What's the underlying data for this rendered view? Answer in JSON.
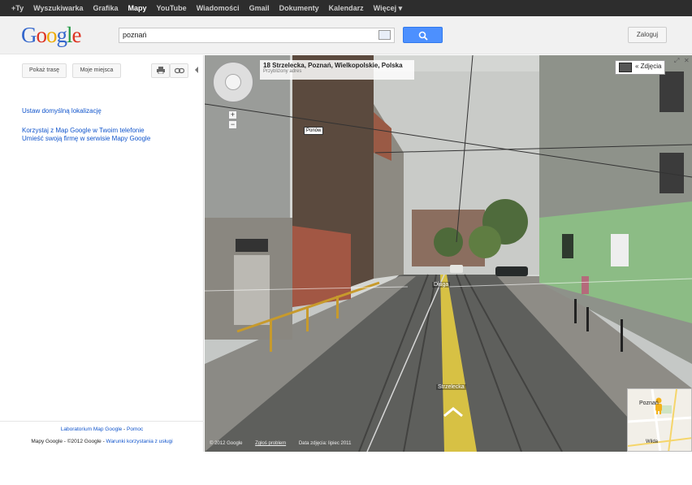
{
  "topbar": {
    "items": [
      {
        "label": "+Ty",
        "active": false
      },
      {
        "label": "Wyszukiwarka",
        "active": false
      },
      {
        "label": "Grafika",
        "active": false
      },
      {
        "label": "Mapy",
        "active": true
      },
      {
        "label": "YouTube",
        "active": false
      },
      {
        "label": "Wiadomości",
        "active": false
      },
      {
        "label": "Gmail",
        "active": false
      },
      {
        "label": "Dokumenty",
        "active": false
      },
      {
        "label": "Kalendarz",
        "active": false
      },
      {
        "label": "Więcej ▾",
        "active": false
      }
    ]
  },
  "header": {
    "logo": {
      "G": "G",
      "o1": "o",
      "o2": "o",
      "g": "g",
      "l": "l",
      "e": "e"
    },
    "search_value": "poznań",
    "login_label": "Zaloguj"
  },
  "panel": {
    "show_traffic_label": "Pokaż trasę",
    "my_places_label": "Moje miejsca",
    "set_location_link": "Ustaw domyślną lokalizację",
    "mobile_link": "Korzystaj z Map Google w Twoim telefonie",
    "business_link": "Umieść swoją firmę w serwisie Mapy Google",
    "footer_lab": "Laboratorium Map Google",
    "footer_help": "Pomoc",
    "footer_copy": "Mapy Google - ©2012 Google",
    "footer_terms": "Warunki korzystania z usługi"
  },
  "streetview": {
    "address": "18 Strzelecka, Poznań, Wielkopolskie, Polska",
    "address_sub": "Przybliżony adres",
    "photos_label": "« Zdjęcia",
    "tooltip": "Ponów",
    "street_label_far": "Długa",
    "street_label_near": "Strzelecka",
    "copyright": "© 2012 Google",
    "report": "Zgłoś problem",
    "date": "Data zdjęcia: lipiec 2011",
    "minimap_city": "Poznań",
    "minimap_sub": "Wilda"
  },
  "colors": {
    "accent": "#4d90fe",
    "link": "#1155cc",
    "bar": "#2d2d2d"
  }
}
